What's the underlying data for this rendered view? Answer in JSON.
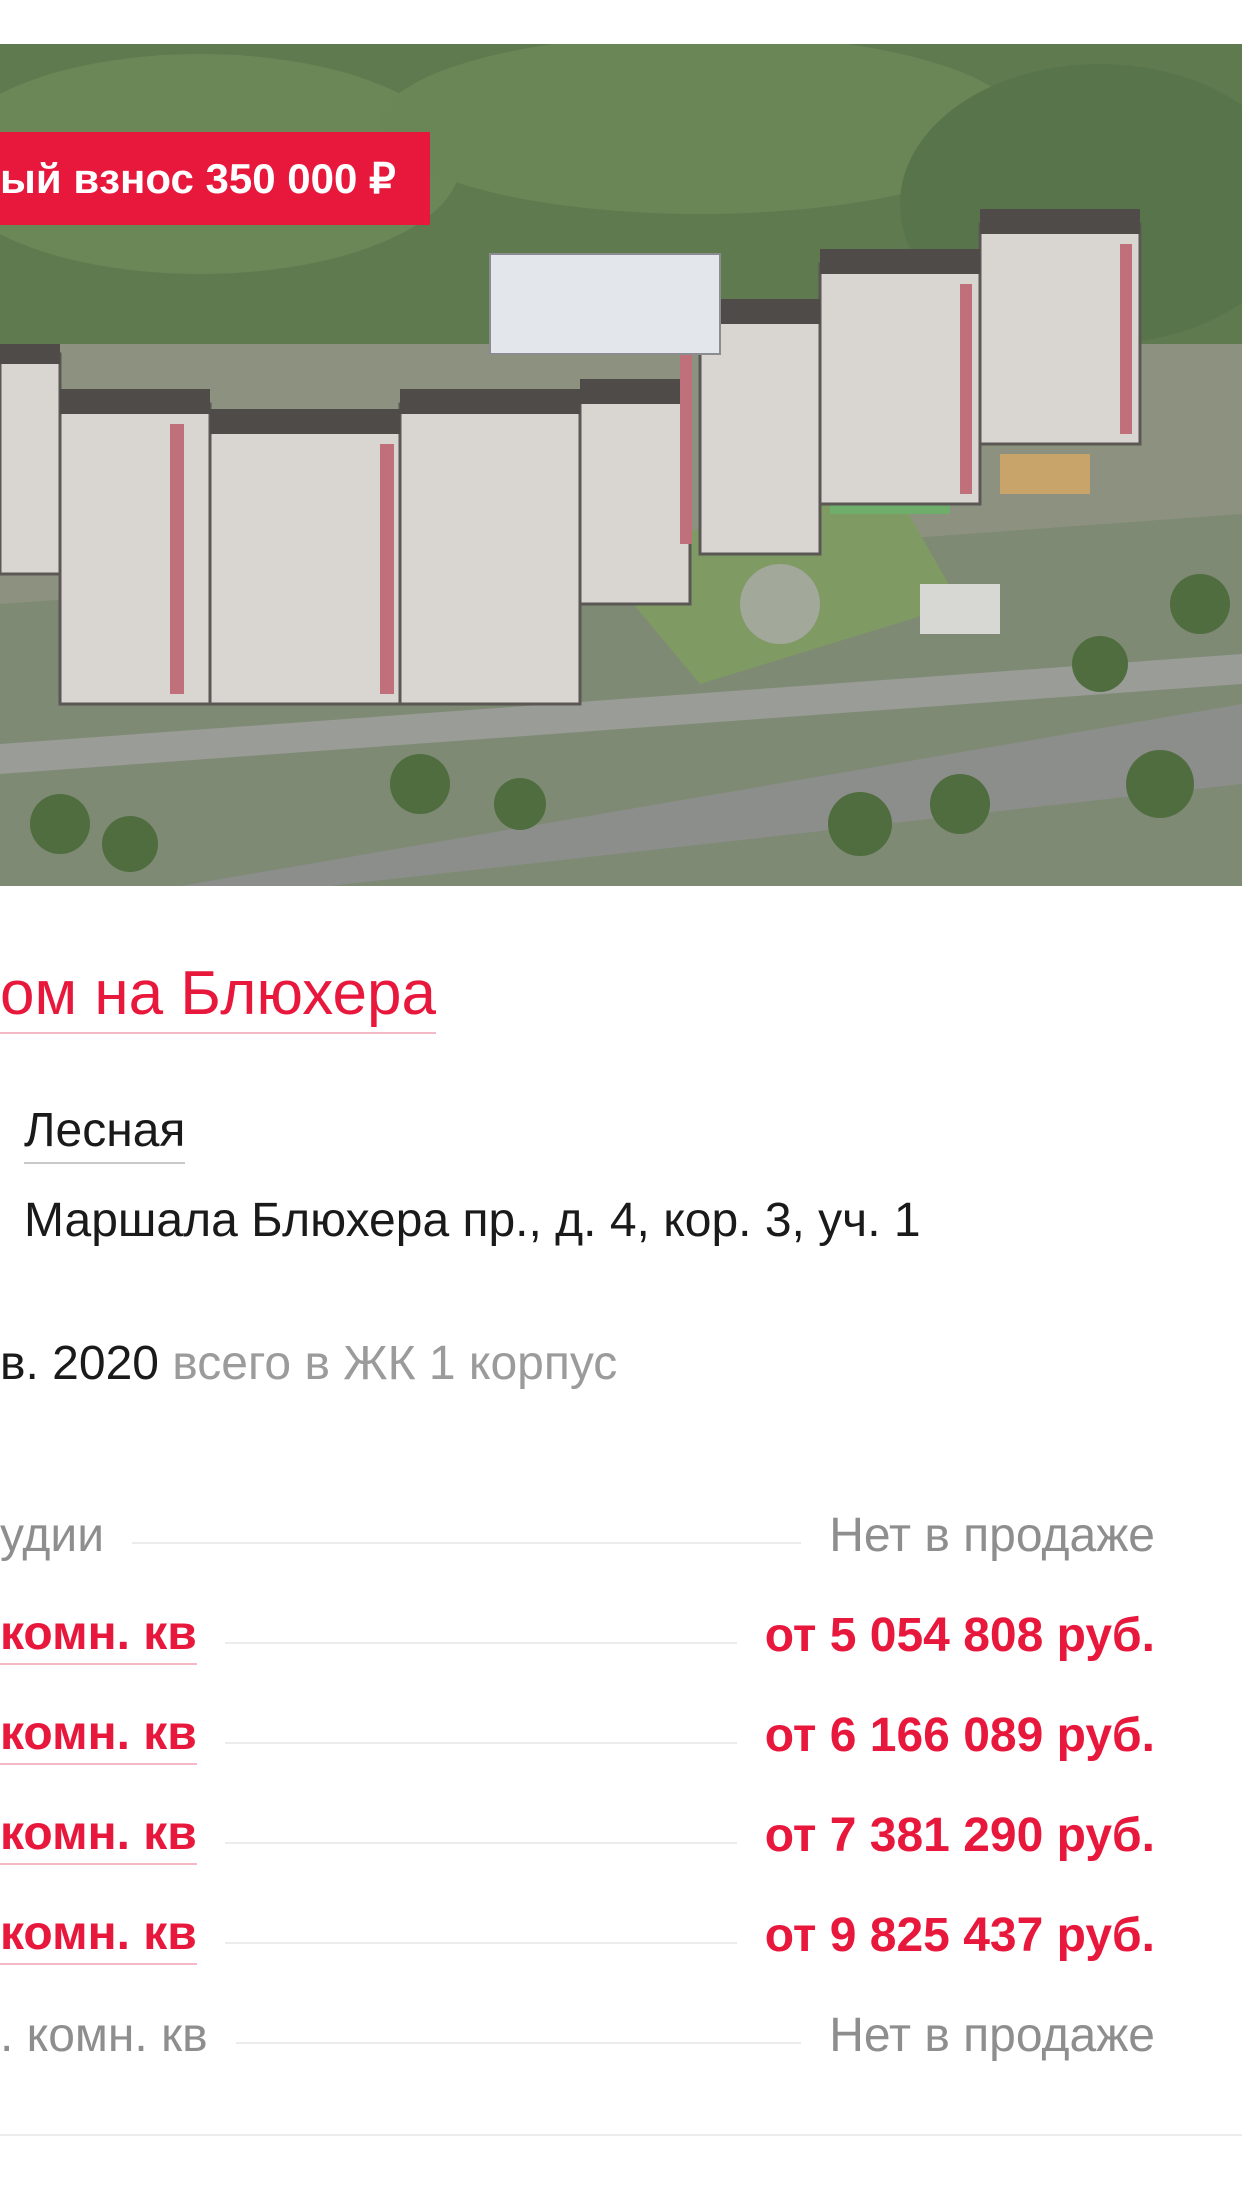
{
  "promo": {
    "badge_text": "ый взнос 350 000 ₽"
  },
  "complex": {
    "title": "ом на Блюхера",
    "metro": "Лесная",
    "address": "Маршала Блюхера пр., д. 4, кор. 3, уч. 1",
    "deadline": "в. 2020",
    "buildings_note": "всего в ЖК 1 корпус"
  },
  "prices": [
    {
      "label": "удии",
      "value": "Нет в продаже",
      "available": false
    },
    {
      "label": "комн. кв",
      "value": "от 5 054 808 руб.",
      "available": true
    },
    {
      "label": "комн. кв",
      "value": "от 6 166 089 руб.",
      "available": true
    },
    {
      "label": "комн. кв",
      "value": "от 7 381 290 руб.",
      "available": true
    },
    {
      "label": "комн. кв",
      "value": "от 9 825 437 руб.",
      "available": true
    },
    {
      "label": ". комн. кв",
      "value": "Нет в продаже",
      "available": false
    }
  ],
  "colors": {
    "accent": "#e8183d",
    "muted": "#8e8e8e",
    "text": "#1a1a1a"
  }
}
